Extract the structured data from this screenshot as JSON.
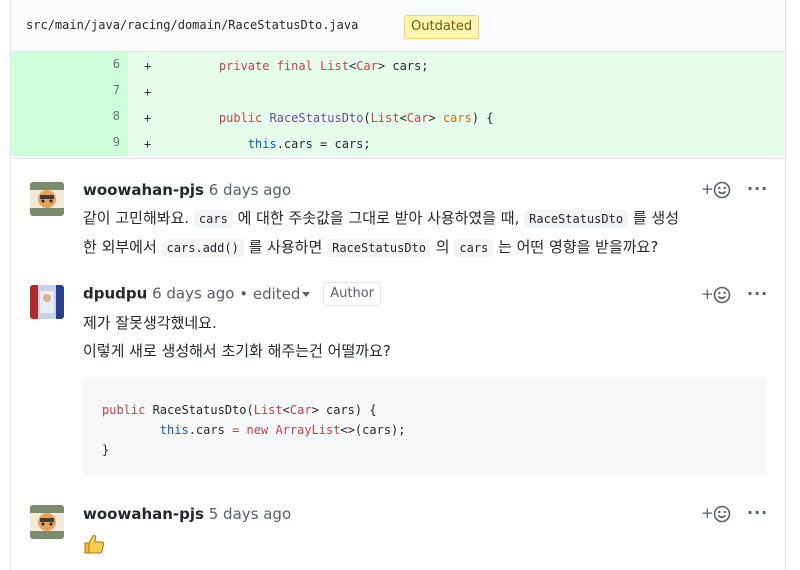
{
  "file": {
    "path": "src/main/java/racing/domain/RaceStatusDto.java",
    "badge": "Outdated"
  },
  "diff": {
    "lines": [
      {
        "num": "6",
        "marker": "+",
        "code": "    private final List<Car> cars;"
      },
      {
        "num": "7",
        "marker": "+",
        "code": ""
      },
      {
        "num": "8",
        "marker": "+",
        "code": "    public RaceStatusDto(List<Car> cars) {"
      },
      {
        "num": "9",
        "marker": "+",
        "code": "        this.cars = cars;"
      }
    ]
  },
  "comments": [
    {
      "author": "woowahan-pjs",
      "time": "6 days ago",
      "line1": {
        "t1": "같이 고민해봐요. ",
        "c1": "cars",
        "t2": " 에 대한 주솟값을 그대로 받아 사용하였을 때, ",
        "c2": "RaceStatusDto",
        "t3": " 를 생성"
      },
      "line2": {
        "t1": "한 외부에서 ",
        "c1": "cars.add()",
        "t2": " 를 사용하면 ",
        "c2": "RaceStatusDto",
        "t3": " 의 ",
        "c3": "cars",
        "t4": " 는 어떤 영향을 받을까요?"
      }
    },
    {
      "author": "dpudpu",
      "time": "6 days ago",
      "edited": "• edited",
      "badge": "Author",
      "line1": "제가 잘못생각했네요.",
      "line2": "이렇게 새로 생성해서 초기화 해주는건 어떨까요?",
      "code": [
        "public RaceStatusDto(List<Car> cars) {",
        "        this.cars = new ArrayList<>(cars);",
        "}"
      ]
    },
    {
      "author": "woowahan-pjs",
      "time": "5 days ago",
      "body": "👍"
    }
  ],
  "icons": {
    "add_reaction": "smiley-plus-icon",
    "more": "kebab-horizontal-icon"
  },
  "colors": {
    "addition_bg": "#e6ffed",
    "addition_gutter": "#cdffd8",
    "outdated_bg": "#fff5b1",
    "keyword": "#d73a49",
    "type": "#6f42c1"
  }
}
